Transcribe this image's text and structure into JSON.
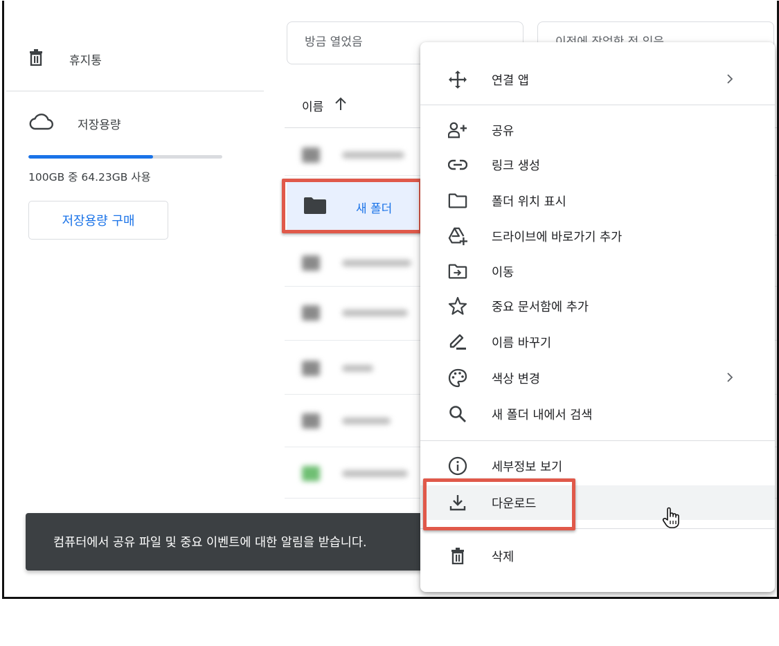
{
  "sidebar": {
    "trash_label": "휴지통",
    "storage_label": "저장용량",
    "storage_used_fraction": 0.6423,
    "storage_text": "100GB 중 64.23GB 사용",
    "buy_button_label": "저장용량 구매"
  },
  "top_cards": {
    "card1_text": "방금 열었음",
    "card2_text": "이전에 작업한 적 있음"
  },
  "file_list": {
    "header_label": "이름",
    "sort_icon": "arrow-up-icon",
    "selected_folder_name": "새 폴더"
  },
  "snackbar": {
    "message": "컴퓨터에서 공유 파일 및 중요 이벤트에 대한 알림을 받습니다."
  },
  "context_menu": {
    "open_with": "연결 앱",
    "share": "공유",
    "get_link": "링크 생성",
    "show_folder_location": "폴더 위치 표시",
    "add_shortcut": "드라이브에 바로가기 추가",
    "move": "이동",
    "add_starred": "중요 문서함에 추가",
    "rename": "이름 바꾸기",
    "change_color": "색상 변경",
    "search_within": "새 폴더 내에서 검색",
    "view_details": "세부정보 보기",
    "download": "다운로드",
    "remove": "삭제"
  },
  "colors": {
    "accent": "#1a73e8",
    "highlight_box": "#e0594a",
    "snackbar_bg": "#3c4043"
  }
}
